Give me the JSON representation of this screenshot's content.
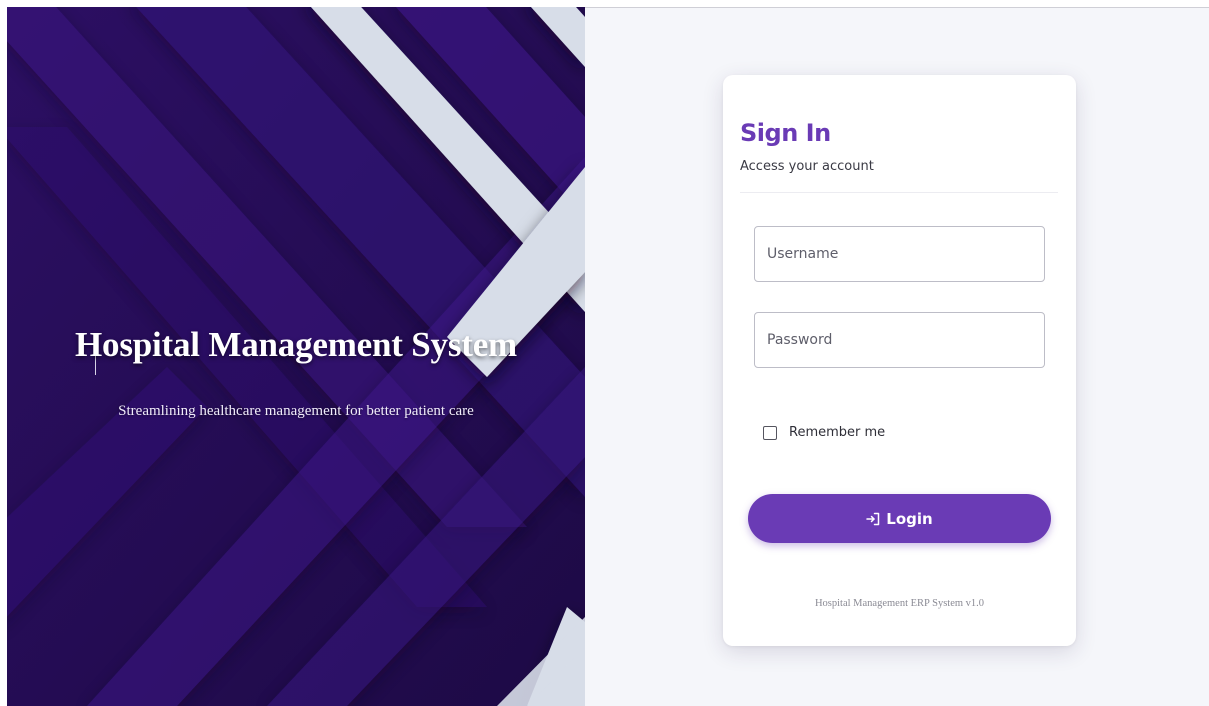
{
  "hero": {
    "title": "Hospital Management System",
    "subtitle": "Streamlining healthcare management for better patient care"
  },
  "login_card": {
    "title": "Sign In",
    "subtitle": "Access your account",
    "username_placeholder": "Username",
    "password_placeholder": "Password",
    "remember_label": "Remember me",
    "remember_checked": false,
    "login_label": "Login",
    "login_icon": "login-icon",
    "footer": "Hospital Management ERP System v1.0"
  },
  "colors": {
    "accent": "#6a3bb5",
    "hero_background": "#2a0f5e",
    "hero_stripe_light": "#d7dde8",
    "page_background": "#f5f6fa"
  }
}
